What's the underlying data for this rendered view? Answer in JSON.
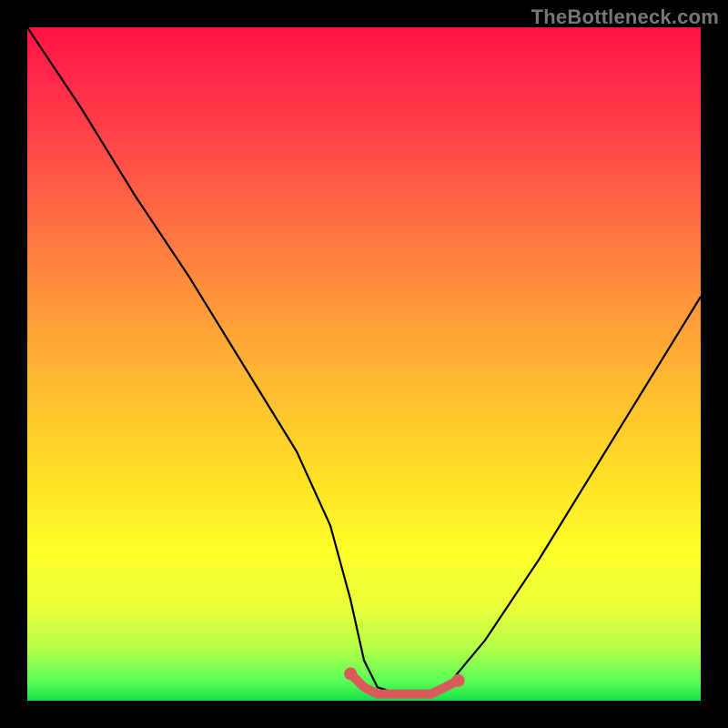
{
  "watermark": "TheBottleneck.com",
  "chart_data": {
    "type": "line",
    "title": "",
    "xlabel": "",
    "ylabel": "",
    "x_range": [
      0,
      100
    ],
    "y_range": [
      0,
      100
    ],
    "series": [
      {
        "name": "black-curve",
        "color": "#000000",
        "x": [
          0,
          8,
          16,
          24,
          32,
          40,
          45,
          48,
          50,
          52,
          55,
          58,
          61,
          63,
          68,
          76,
          84,
          92,
          100
        ],
        "values": [
          100,
          88,
          75,
          63,
          50,
          37,
          26,
          15,
          6,
          2,
          1,
          1,
          1,
          3,
          9,
          21,
          34,
          47,
          60
        ]
      },
      {
        "name": "red-basin-marker",
        "color": "#d95a5a",
        "x": [
          48,
          50,
          52,
          55,
          58,
          60,
          62,
          64
        ],
        "values": [
          4,
          2,
          1,
          1,
          1,
          1,
          2,
          3
        ]
      }
    ]
  }
}
